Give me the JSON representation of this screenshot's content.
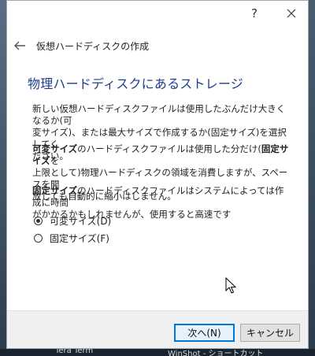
{
  "titlebar": {
    "help_label": "?",
    "close_label": "✕"
  },
  "nav": {
    "back_icon": "back-arrow-icon",
    "title": "仮想ハードディスクの作成"
  },
  "page": {
    "heading": "物理ハードディスクにあるストレージ",
    "intro": [
      "新しい仮想ハードディスクファイルは使用したぶんだけ大きくなるか(可",
      "変サイズ)、または最大サイズで作成するか(固定サイズ)を選択してく",
      "ださい。"
    ],
    "dynamic": {
      "l1_bold": "可変サイズ",
      "l1_text": "のハードディスクファイルは使用した分だけ(",
      "l1_bold2": "固定サイズ",
      "l1_end": "を",
      "l2": "上限として)物理ハードディスクの領域を消費しますが、スペースを開",
      "l3": "放しても自動的に縮小はしません。"
    },
    "fixed": {
      "l1_bold": "固定サイズ",
      "l1_text": "のハードディスクファイルはシステムによっては作成に時間",
      "l2": "がかかるかもしれませんが、使用すると高速です"
    }
  },
  "options": [
    {
      "label": "可変サイズ(D)",
      "checked": true
    },
    {
      "label": "固定サイズ(F)",
      "checked": false
    }
  ],
  "buttons": {
    "next": "次へ(N)",
    "cancel": "キャンセル"
  },
  "taskbar": {
    "item1": "Tera Term",
    "item2": "WinShot - ショートカット"
  }
}
